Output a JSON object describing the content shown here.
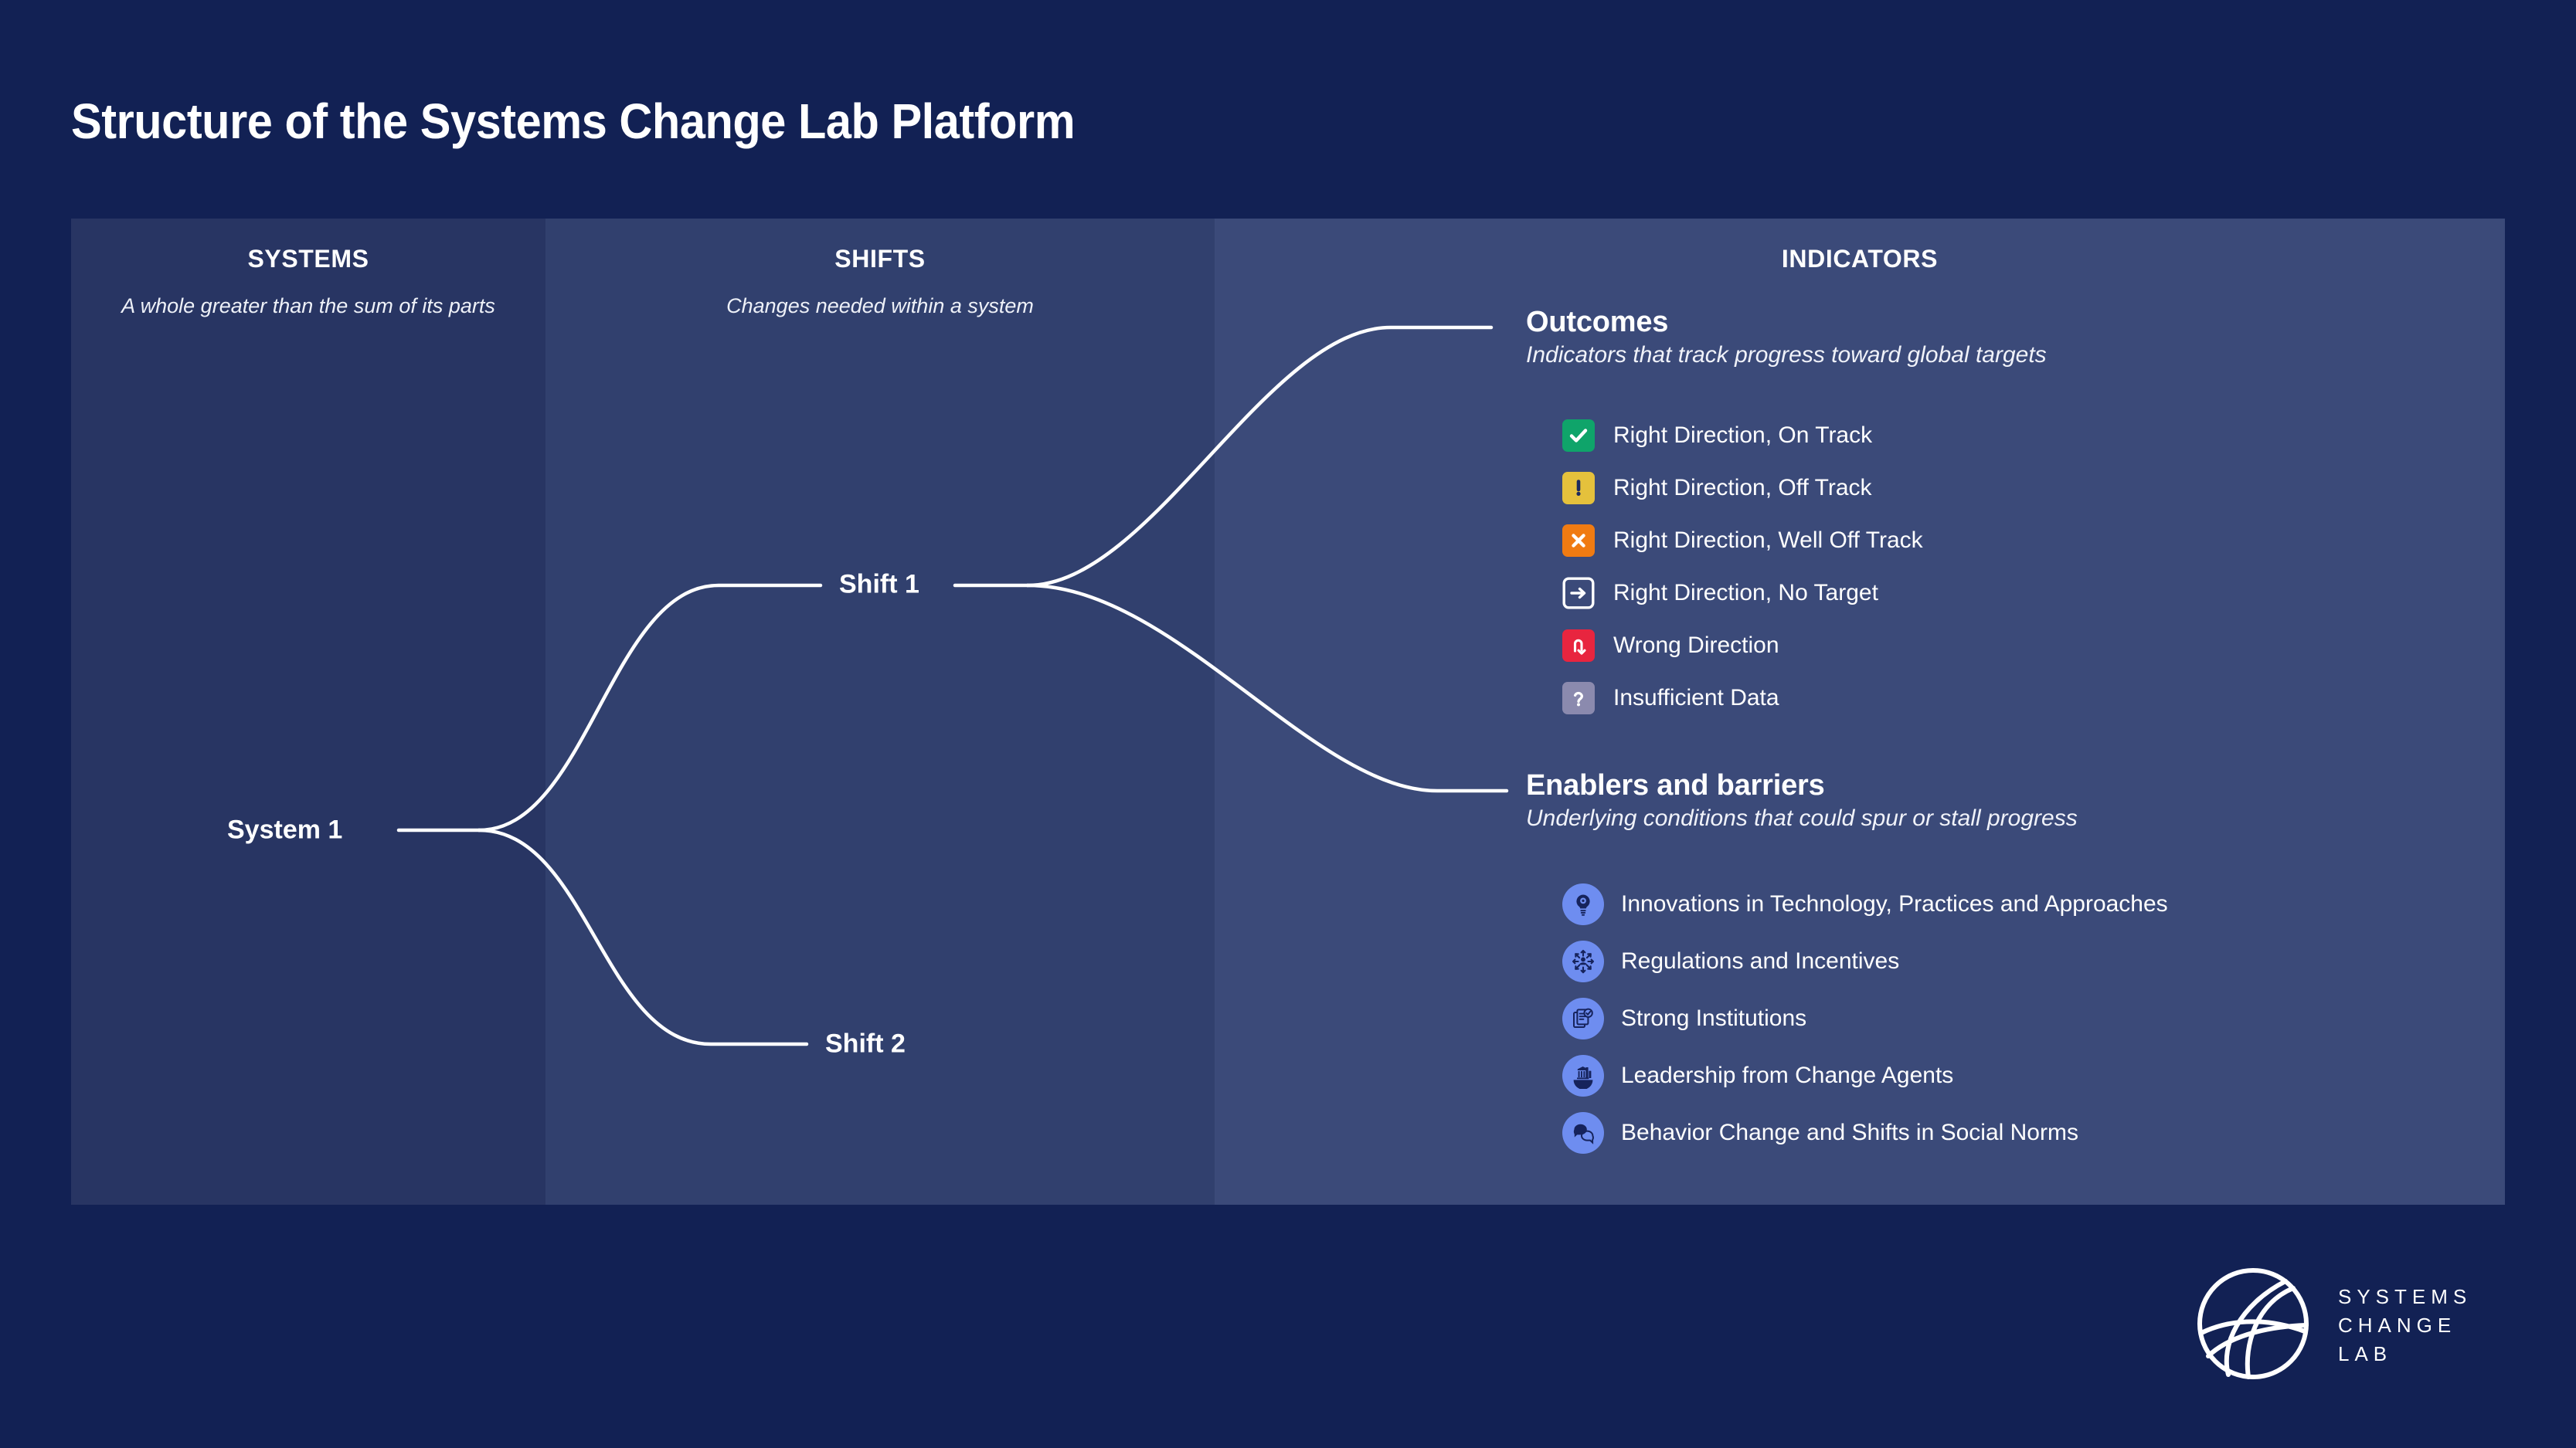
{
  "page": {
    "title": "Structure of the Systems Change Lab Platform",
    "background_color": "#122154"
  },
  "columns": [
    {
      "id": "systems",
      "heading": "SYSTEMS",
      "subtitle": "A whole greater than the sum of its parts",
      "background_color": "#283563"
    },
    {
      "id": "shifts",
      "heading": "SHIFTS",
      "subtitle": "Changes needed within a system",
      "background_color": "#31406E"
    },
    {
      "id": "indicators",
      "heading": "INDICATORS",
      "subtitle": "",
      "background_color": "#3B4A79"
    }
  ],
  "nodes": {
    "system_1": "System 1",
    "shift_1": "Shift 1",
    "shift_2": "Shift 2"
  },
  "groups": {
    "outcomes": {
      "title": "Outcomes",
      "subtitle": "Indicators that track progress toward global targets"
    },
    "enablers": {
      "title": "Enablers and barriers",
      "subtitle": "Underlying conditions that could spur or stall progress"
    }
  },
  "status_legend": [
    {
      "icon": "check-badge-icon",
      "label": "Right Direction, On Track",
      "color": "#0FA46A"
    },
    {
      "icon": "exclamation-badge-icon",
      "label": "Right Direction, Off Track",
      "color": "#E5C13C"
    },
    {
      "icon": "cross-badge-icon",
      "label": "Right Direction, Well Off Track",
      "color": "#F07B12"
    },
    {
      "icon": "arrow-right-badge-icon",
      "label": "Right Direction, No Target",
      "color": "#FFFFFF"
    },
    {
      "icon": "uturn-down-badge-icon",
      "label": "Wrong Direction",
      "color": "#E8253F"
    },
    {
      "icon": "question-badge-icon",
      "label": "Insufficient Data",
      "color": "#8B8AAE"
    }
  ],
  "enablers": [
    {
      "icon": "lightbulb-gear-icon",
      "label": "Innovations in Technology, Practices and Approaches"
    },
    {
      "icon": "radiating-arrows-icon",
      "label": "Regulations and Incentives"
    },
    {
      "icon": "document-check-icon",
      "label": "Strong Institutions"
    },
    {
      "icon": "city-buildings-icon",
      "label": "Leadership from Change Agents"
    },
    {
      "icon": "speech-bubbles-icon",
      "label": "Behavior Change and Shifts in Social Norms"
    }
  ],
  "logo": {
    "line1": "SYSTEMS",
    "line2": "CHANGE",
    "line3": "LAB"
  }
}
